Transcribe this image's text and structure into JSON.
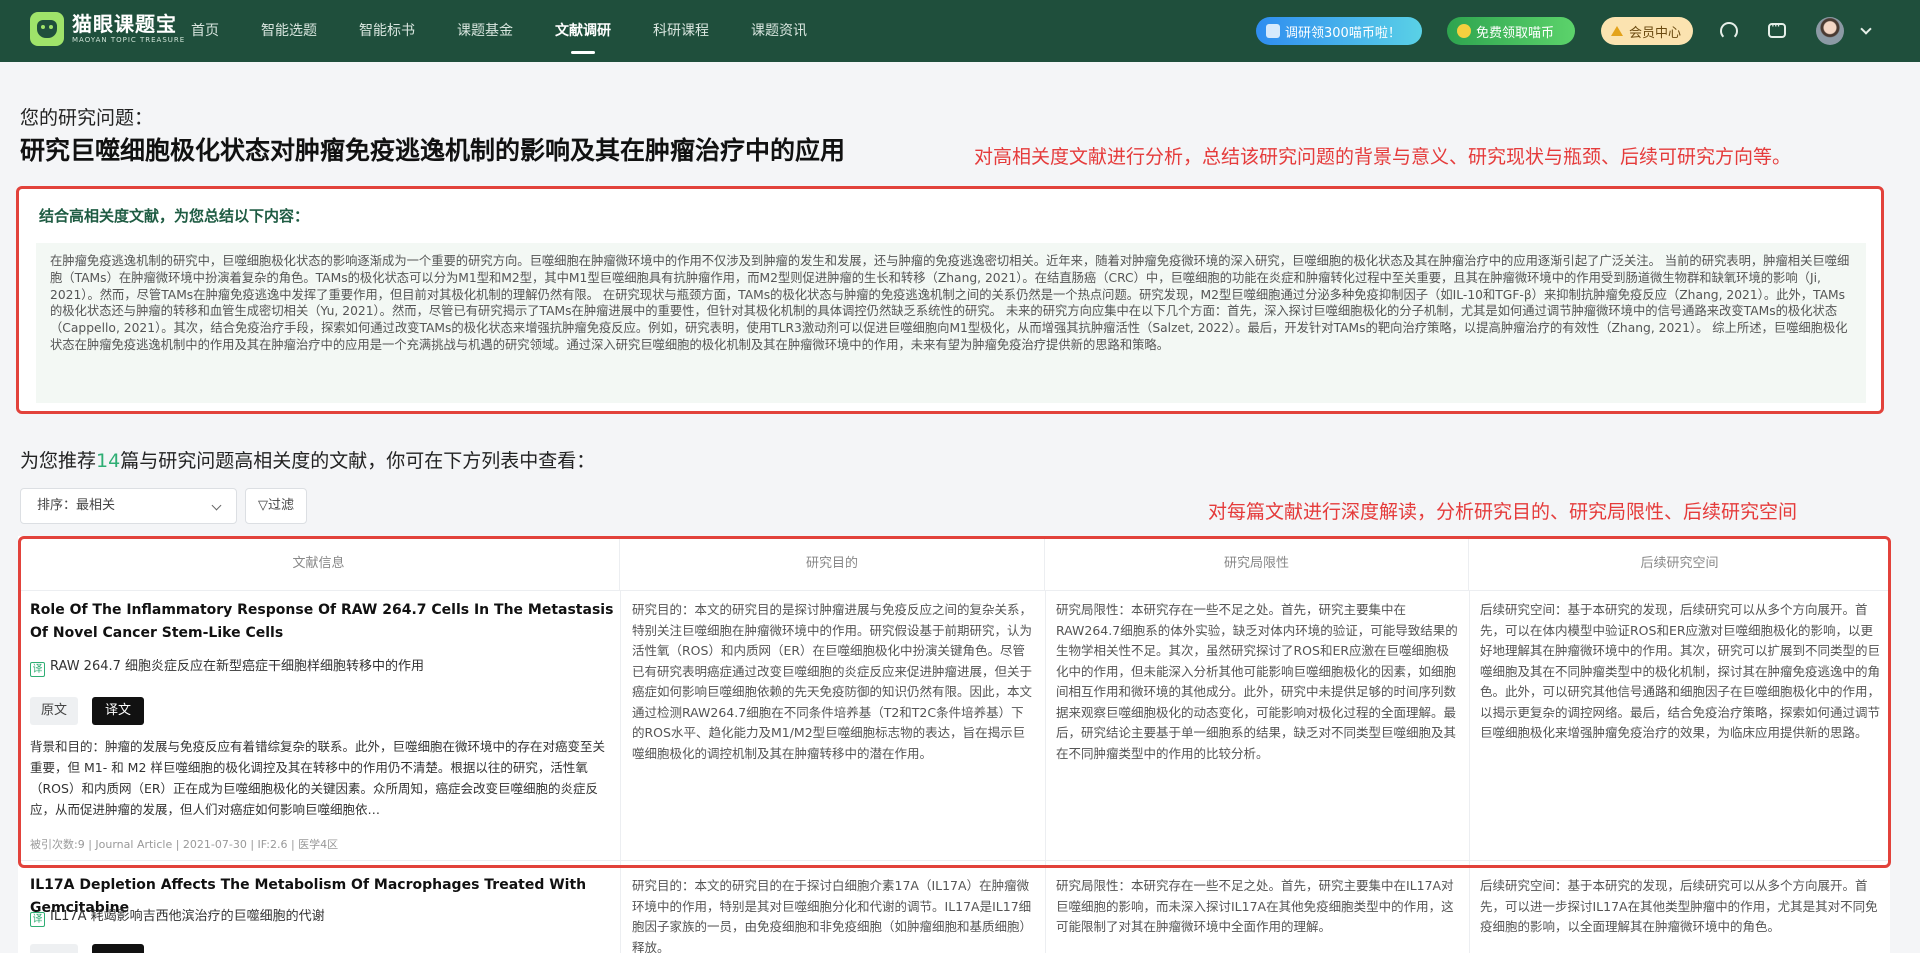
{
  "nav": {
    "logo_title": "猫眼课题宝",
    "logo_sub": "MAOYAN TOPIC TREASURE",
    "menu": [
      "首页",
      "智能选题",
      "智能标书",
      "课题基金",
      "文献调研",
      "科研课程",
      "课题资讯"
    ],
    "active_menu": "文献调研",
    "promo_1": "调研领300喵币啦！",
    "promo_2": "免费领取喵币",
    "vip": "会员中心"
  },
  "header": {
    "label": "您的研究问题：",
    "title": "研究巨噬细胞极化状态对肿瘤免疫逃逸机制的影响及其在肿瘤治疗中的应用",
    "annotation_1": "对高相关度文献进行分析，总结该研究问题的背景与意义、研究现状与瓶颈、后续可研究方向等。",
    "annotation_2": "对每篇文献进行深度解读，分析研究目的、研究局限性、后续研究空间"
  },
  "summary": {
    "title": "结合高相关度文献，为您总结以下内容：",
    "body": "在肿瘤免疫逃逸机制的研究中，巨噬细胞极化状态的影响逐渐成为一个重要的研究方向。巨噬细胞在肿瘤微环境中的作用不仅涉及到肿瘤的发生和发展，还与肿瘤的免疫逃逸密切相关。近年来，随着对肿瘤免疫微环境的深入研究，巨噬细胞的极化状态及其在肿瘤治疗中的应用逐渐引起了广泛关注。 当前的研究表明，肿瘤相关巨噬细胞（TAMs）在肿瘤微环境中扮演着复杂的角色。TAMs的极化状态可以分为M1型和M2型，其中M1型巨噬细胞具有抗肿瘤作用，而M2型则促进肿瘤的生长和转移（Zhang, 2021）。在结直肠癌（CRC）中，巨噬细胞的功能在炎症和肿瘤转化过程中至关重要，且其在肿瘤微环境中的作用受到肠道微生物群和缺氧环境的影响（Ji, 2021）。然而，尽管TAMs在肿瘤免疫逃逸中发挥了重要作用，但目前对其极化机制的理解仍然有限。 在研究现状与瓶颈方面，TAMs的极化状态与肿瘤的免疫逃逸机制之间的关系仍然是一个热点问题。研究发现，M2型巨噬细胞通过分泌多种免疫抑制因子（如IL-10和TGF-β）来抑制抗肿瘤免疫反应（Zhang, 2021）。此外，TAMs的极化状态还与肿瘤的转移和血管生成密切相关（Yu, 2021）。然而，尽管已有研究揭示了TAMs在肿瘤进展中的重要性，但针对其极化机制的具体调控仍然缺乏系统性的研究。 未来的研究方向应集中在以下几个方面：首先，深入探讨巨噬细胞极化的分子机制，尤其是如何通过调节肿瘤微环境中的信号通路来改变TAMs的极化状态（Cappello, 2021）。其次，结合免疫治疗手段，探索如何通过改变TAMs的极化状态来增强抗肿瘤免疫反应。例如，研究表明，使用TLR3激动剂可以促进巨噬细胞向M1型极化，从而增强其抗肿瘤活性（Salzet, 2022）。最后，开发针对TAMs的靶向治疗策略，以提高肿瘤治疗的有效性（Zhang, 2021）。 综上所述，巨噬细胞极化状态在肿瘤免疫逃逸机制中的作用及其在肿瘤治疗中的应用是一个充满挑战与机遇的研究领域。通过深入研究巨噬细胞的极化机制及其在肿瘤微环境中的作用，未来有望为肿瘤免疫治疗提供新的思路和策略。"
  },
  "recommend": {
    "prefix": "为您推荐",
    "count": "14",
    "suffix": "篇与研究问题高相关度的文献，你可在下方列表中查看："
  },
  "controls": {
    "sort": "排序：最相关",
    "filter": "过滤"
  },
  "table": {
    "headers": [
      "文献信息",
      "研究目的",
      "研究局限性",
      "后续研究空间"
    ],
    "rows": [
      {
        "en_title": "Role Of The Inflammatory Response Of RAW 264.7 Cells In The Metastasis Of Novel Cancer Stem-Like Cells",
        "yi": "译",
        "cn_title": "RAW 264.7 细胞炎症反应在新型癌症干细胞样细胞转移中的作用",
        "btn_orig": "原文",
        "btn_tran": "译文",
        "abstract": "背景和目的：肿瘤的发展与免疫反应有着错综复杂的联系。此外，巨噬细胞在微环境中的存在对癌变至关重要，但 M1- 和 M2 样巨噬细胞的极化调控及其在转移中的作用仍不清楚。根据以往的研究，活性氧（ROS）和内质网（ER）正在成为巨噬细胞极化的关键因素。众所周知，癌症会改变巨噬细胞的炎症反应，从而促进肿瘤的发展，但人们对癌症如何影响巨噬细胞依…",
        "meta": "被引次数:9 | Journal Article | 2021-07-30 | IF:2.6 | 医学4区",
        "purpose": "研究目的：本文的研究目的是探讨肿瘤进展与免疫反应之间的复杂关系，特别关注巨噬细胞在肿瘤微环境中的作用。研究假设基于前期研究，认为活性氧（ROS）和内质网（ER）在巨噬细胞极化中扮演关键角色。尽管已有研究表明癌症通过改变巨噬细胞的炎症反应来促进肿瘤进展，但关于癌症如何影响巨噬细胞依赖的先天免疫防御的知识仍然有限。因此，本文通过检测RAW264.7细胞在不同条件培养基（T2和T2C条件培养基）下的ROS水平、趋化能力及M1/M2型巨噬细胞标志物的表达，旨在揭示巨噬细胞极化的调控机制及其在肿瘤转移中的潜在作用。",
        "limitation": "研究局限性：本研究存在一些不足之处。首先，研究主要集中在RAW264.7细胞系的体外实验，缺乏对体内环境的验证，可能导致结果的生物学相关性不足。其次，虽然研究探讨了ROS和ER应激在巨噬细胞极化中的作用，但未能深入分析其他可能影响巨噬细胞极化的因素，如细胞间相互作用和微环境的其他成分。此外，研究中未提供足够的时间序列数据来观察巨噬细胞极化的动态变化，可能影响对极化过程的全面理解。最后，研究结论主要基于单一细胞系的结果，缺乏对不同类型巨噬细胞及其在不同肿瘤类型中的作用的比较分析。",
        "future": "后续研究空间：基于本研究的发现，后续研究可以从多个方向展开。首先，可以在体内模型中验证ROS和ER应激对巨噬细胞极化的影响，以更好地理解其在肿瘤微环境中的作用。其次，研究可以扩展到不同类型的巨噬细胞及其在不同肿瘤类型中的极化机制，探讨其在肿瘤免疫逃逸中的角色。此外，可以研究其他信号通路和细胞因子在巨噬细胞极化中的作用，以揭示更复杂的调控网络。最后，结合免疫治疗策略，探索如何通过调节巨噬细胞极化来增强肿瘤免疫治疗的效果，为临床应用提供新的思路。"
      },
      {
        "en_title": "IL17A Depletion Affects The Metabolism Of Macrophages Treated With Gemcitabine",
        "yi": "译",
        "cn_title": "IL17A 耗竭影响吉西他滨治疗的巨噬细胞的代谢",
        "purpose": "研究目的：本文的研究目的在于探讨白细胞介素17A（IL17A）在肿瘤微环境中的作用，特别是其对巨噬细胞分化和代谢的调节。IL17A是IL17细胞因子家族的一员，由免疫细胞和非免疫细胞（如肿瘤细胞和基质细胞）释放。",
        "limitation": "研究局限性：本研究存在一些不足之处。首先，研究主要集中在IL17A对巨噬细胞的影响，而未深入探讨IL17A在其他免疫细胞类型中的作用，这可能限制了对其在肿瘤微环境中全面作用的理解。",
        "future": "后续研究空间：基于本研究的发现，后续研究可以从多个方向展开。首先，可以进一步探讨IL17A在其他类型肿瘤中的作用，尤其是其对不同免疫细胞的影响，以全面理解其在肿瘤微环境中的角色。"
      }
    ]
  }
}
